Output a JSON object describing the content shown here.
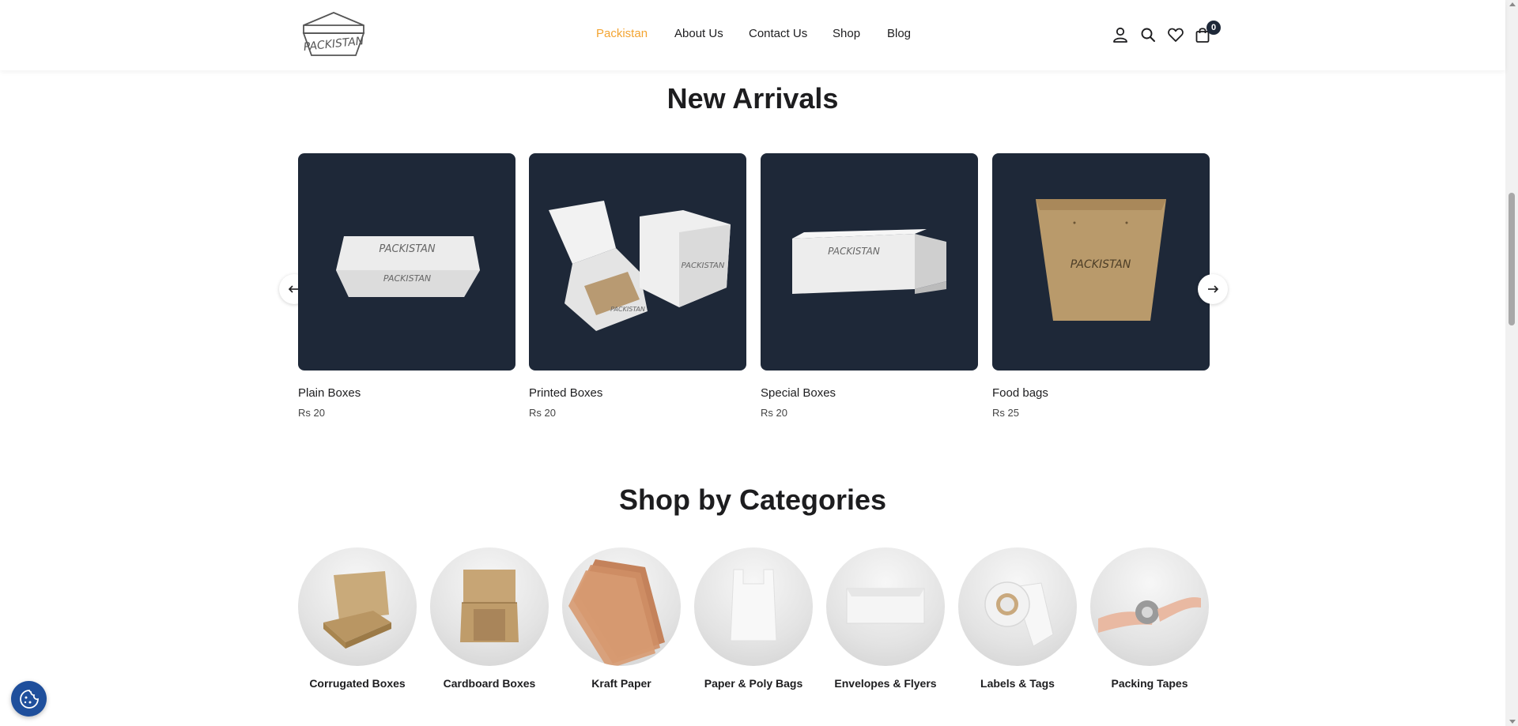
{
  "brand": {
    "logo_text": "PACKISTAN",
    "accent_color": "#f3a431",
    "dark_color": "#1e2838"
  },
  "nav": {
    "items": [
      {
        "label": "Packistan",
        "active": true
      },
      {
        "label": "About Us",
        "active": false
      },
      {
        "label": "Contact Us",
        "active": false
      },
      {
        "label": "Shop",
        "active": false
      },
      {
        "label": "Blog",
        "active": false
      }
    ]
  },
  "header_icons": [
    "user-icon",
    "search-icon",
    "heart-icon",
    "cart-icon"
  ],
  "cart": {
    "count": "0"
  },
  "new_arrivals": {
    "title": "New Arrivals",
    "products": [
      {
        "name": "Plain Boxes",
        "price": "Rs 20"
      },
      {
        "name": "Printed Boxes",
        "price": "Rs 20"
      },
      {
        "name": "Special Boxes",
        "price": "Rs 20"
      },
      {
        "name": "Food bags",
        "price": "Rs 25"
      }
    ]
  },
  "categories": {
    "title": "Shop by Categories",
    "items": [
      {
        "label": "Corrugated Boxes"
      },
      {
        "label": "Cardboard Boxes"
      },
      {
        "label": "Kraft Paper"
      },
      {
        "label": "Paper & Poly Bags"
      },
      {
        "label": "Envelopes & Flyers"
      },
      {
        "label": "Labels & Tags"
      },
      {
        "label": "Packing Tapes"
      }
    ]
  }
}
